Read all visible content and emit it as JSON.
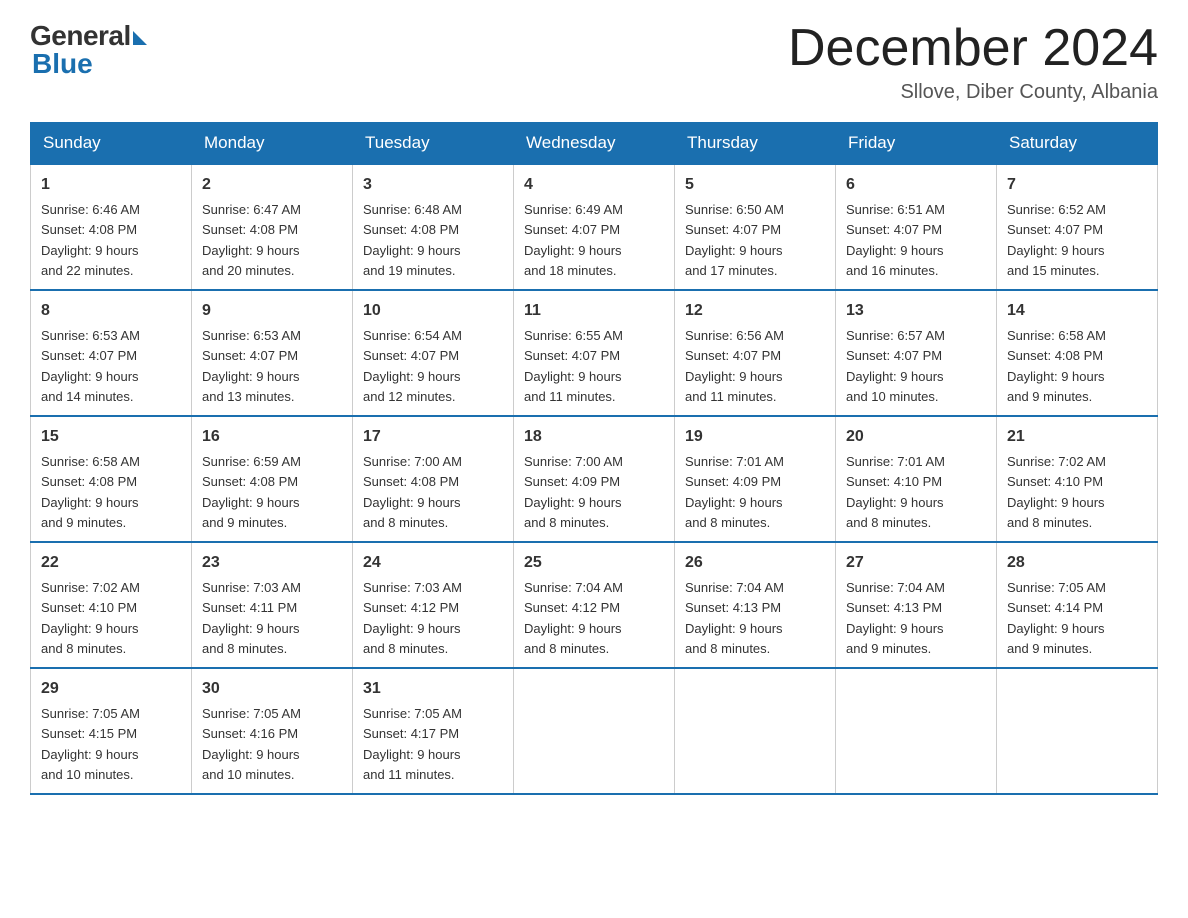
{
  "header": {
    "logo_general": "General",
    "logo_blue": "Blue",
    "title": "December 2024",
    "location": "Sllove, Diber County, Albania"
  },
  "days_header": [
    "Sunday",
    "Monday",
    "Tuesday",
    "Wednesday",
    "Thursday",
    "Friday",
    "Saturday"
  ],
  "weeks": [
    [
      {
        "day": "1",
        "sunrise": "6:46 AM",
        "sunset": "4:08 PM",
        "daylight": "9 hours and 22 minutes."
      },
      {
        "day": "2",
        "sunrise": "6:47 AM",
        "sunset": "4:08 PM",
        "daylight": "9 hours and 20 minutes."
      },
      {
        "day": "3",
        "sunrise": "6:48 AM",
        "sunset": "4:08 PM",
        "daylight": "9 hours and 19 minutes."
      },
      {
        "day": "4",
        "sunrise": "6:49 AM",
        "sunset": "4:07 PM",
        "daylight": "9 hours and 18 minutes."
      },
      {
        "day": "5",
        "sunrise": "6:50 AM",
        "sunset": "4:07 PM",
        "daylight": "9 hours and 17 minutes."
      },
      {
        "day": "6",
        "sunrise": "6:51 AM",
        "sunset": "4:07 PM",
        "daylight": "9 hours and 16 minutes."
      },
      {
        "day": "7",
        "sunrise": "6:52 AM",
        "sunset": "4:07 PM",
        "daylight": "9 hours and 15 minutes."
      }
    ],
    [
      {
        "day": "8",
        "sunrise": "6:53 AM",
        "sunset": "4:07 PM",
        "daylight": "9 hours and 14 minutes."
      },
      {
        "day": "9",
        "sunrise": "6:53 AM",
        "sunset": "4:07 PM",
        "daylight": "9 hours and 13 minutes."
      },
      {
        "day": "10",
        "sunrise": "6:54 AM",
        "sunset": "4:07 PM",
        "daylight": "9 hours and 12 minutes."
      },
      {
        "day": "11",
        "sunrise": "6:55 AM",
        "sunset": "4:07 PM",
        "daylight": "9 hours and 11 minutes."
      },
      {
        "day": "12",
        "sunrise": "6:56 AM",
        "sunset": "4:07 PM",
        "daylight": "9 hours and 11 minutes."
      },
      {
        "day": "13",
        "sunrise": "6:57 AM",
        "sunset": "4:07 PM",
        "daylight": "9 hours and 10 minutes."
      },
      {
        "day": "14",
        "sunrise": "6:58 AM",
        "sunset": "4:08 PM",
        "daylight": "9 hours and 9 minutes."
      }
    ],
    [
      {
        "day": "15",
        "sunrise": "6:58 AM",
        "sunset": "4:08 PM",
        "daylight": "9 hours and 9 minutes."
      },
      {
        "day": "16",
        "sunrise": "6:59 AM",
        "sunset": "4:08 PM",
        "daylight": "9 hours and 9 minutes."
      },
      {
        "day": "17",
        "sunrise": "7:00 AM",
        "sunset": "4:08 PM",
        "daylight": "9 hours and 8 minutes."
      },
      {
        "day": "18",
        "sunrise": "7:00 AM",
        "sunset": "4:09 PM",
        "daylight": "9 hours and 8 minutes."
      },
      {
        "day": "19",
        "sunrise": "7:01 AM",
        "sunset": "4:09 PM",
        "daylight": "9 hours and 8 minutes."
      },
      {
        "day": "20",
        "sunrise": "7:01 AM",
        "sunset": "4:10 PM",
        "daylight": "9 hours and 8 minutes."
      },
      {
        "day": "21",
        "sunrise": "7:02 AM",
        "sunset": "4:10 PM",
        "daylight": "9 hours and 8 minutes."
      }
    ],
    [
      {
        "day": "22",
        "sunrise": "7:02 AM",
        "sunset": "4:10 PM",
        "daylight": "9 hours and 8 minutes."
      },
      {
        "day": "23",
        "sunrise": "7:03 AM",
        "sunset": "4:11 PM",
        "daylight": "9 hours and 8 minutes."
      },
      {
        "day": "24",
        "sunrise": "7:03 AM",
        "sunset": "4:12 PM",
        "daylight": "9 hours and 8 minutes."
      },
      {
        "day": "25",
        "sunrise": "7:04 AM",
        "sunset": "4:12 PM",
        "daylight": "9 hours and 8 minutes."
      },
      {
        "day": "26",
        "sunrise": "7:04 AM",
        "sunset": "4:13 PM",
        "daylight": "9 hours and 8 minutes."
      },
      {
        "day": "27",
        "sunrise": "7:04 AM",
        "sunset": "4:13 PM",
        "daylight": "9 hours and 9 minutes."
      },
      {
        "day": "28",
        "sunrise": "7:05 AM",
        "sunset": "4:14 PM",
        "daylight": "9 hours and 9 minutes."
      }
    ],
    [
      {
        "day": "29",
        "sunrise": "7:05 AM",
        "sunset": "4:15 PM",
        "daylight": "9 hours and 10 minutes."
      },
      {
        "day": "30",
        "sunrise": "7:05 AM",
        "sunset": "4:16 PM",
        "daylight": "9 hours and 10 minutes."
      },
      {
        "day": "31",
        "sunrise": "7:05 AM",
        "sunset": "4:17 PM",
        "daylight": "9 hours and 11 minutes."
      },
      null,
      null,
      null,
      null
    ]
  ],
  "labels": {
    "sunrise": "Sunrise:",
    "sunset": "Sunset:",
    "daylight": "Daylight:"
  }
}
